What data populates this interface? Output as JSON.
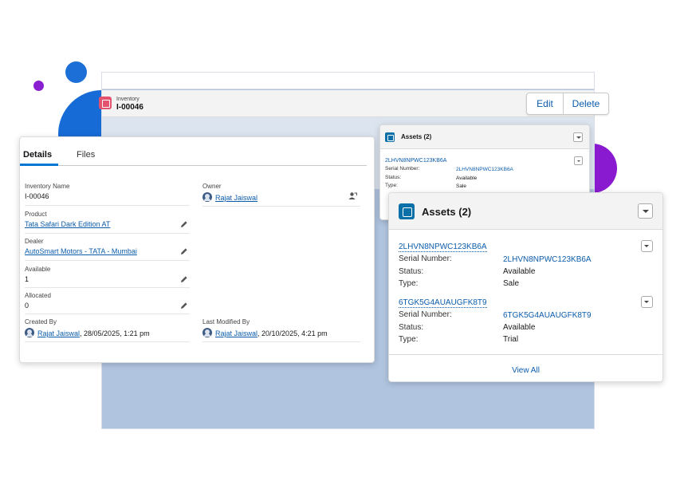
{
  "header": {
    "object_label": "Inventory",
    "record_name": "I-00046",
    "actions": {
      "edit": "Edit",
      "delete": "Delete"
    }
  },
  "details": {
    "tabs": [
      "Details",
      "Files"
    ],
    "fields": {
      "inventory_name": {
        "label": "Inventory Name",
        "value": "I-00046"
      },
      "product": {
        "label": "Product",
        "value": "Tata Safari Dark Edition AT"
      },
      "dealer": {
        "label": "Dealer",
        "value": "AutoSmart Motors - TATA - Mumbai"
      },
      "available": {
        "label": "Available",
        "value": "1"
      },
      "allocated": {
        "label": "Allocated",
        "value": "0"
      },
      "owner": {
        "label": "Owner",
        "value": "Rajat Jaiswal"
      },
      "created_by": {
        "label": "Created By",
        "user": "Rajat Jaiswal",
        "date": ", 28/05/2025, 1:21 pm"
      },
      "last_modified_by": {
        "label": "Last Modified By",
        "user": "Rajat Jaiswal",
        "date": ", 20/10/2025, 4:21 pm"
      }
    }
  },
  "assets_small": {
    "title": "Assets (2)",
    "item": {
      "name": "2LHVN8NPWC123KB6A",
      "serial_label": "Serial Number:",
      "serial_value": "2LHVN8NPWC123KB6A",
      "status_label": "Status:",
      "status_value": "Available",
      "type_label": "Type:",
      "type_value": "Sale"
    }
  },
  "assets_large": {
    "title": "Assets (2)",
    "items": [
      {
        "name": "2LHVN8NPWC123KB6A",
        "serial_label": "Serial Number:",
        "serial_value": "2LHVN8NPWC123KB6A",
        "status_label": "Status:",
        "status_value": "Available",
        "type_label": "Type:",
        "type_value": "Sale"
      },
      {
        "name": "6TGK5G4AUAUGFK8T9",
        "serial_label": "Serial Number:",
        "serial_value": "6TGK5G4AUAUGFK8T9",
        "status_label": "Status:",
        "status_value": "Available",
        "type_label": "Type:",
        "type_value": "Trial"
      }
    ],
    "view_all": "View All"
  },
  "colors": {
    "link": "#0b5cab",
    "brand": "#0176d3",
    "inventory_icon": "#e3536e",
    "asset_icon": "#0b6fa8",
    "page_background": "#b0c4df",
    "accent_purple": "#8a1fd1",
    "accent_blue": "#176bd6"
  },
  "icons": [
    "inventory-icon",
    "asset-icon",
    "pencil-icon",
    "chevron-down-icon",
    "user-avatar-icon",
    "change-owner-icon"
  ]
}
